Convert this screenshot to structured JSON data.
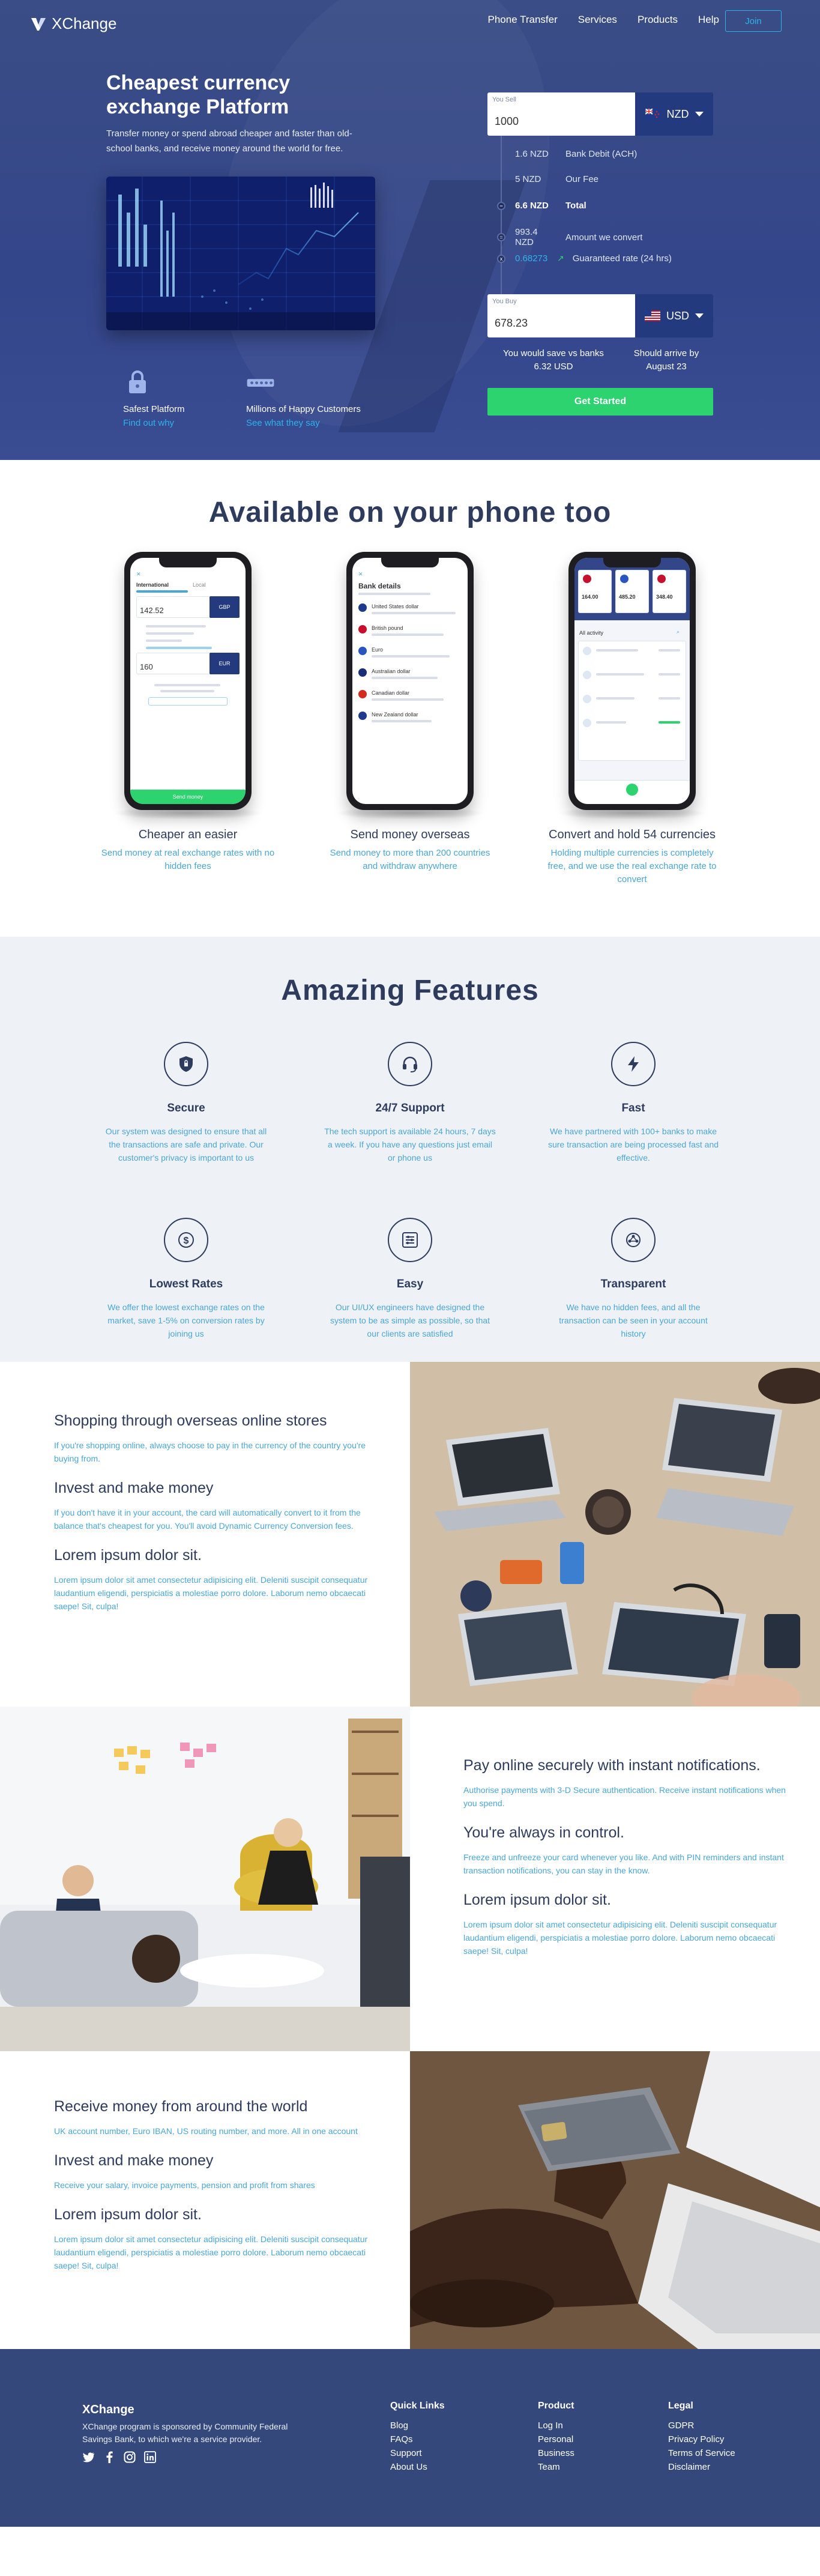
{
  "nav": {
    "brand": "XChange",
    "links": [
      "Phone Transfer",
      "Services",
      "Products",
      "Help"
    ],
    "join": "Join"
  },
  "hero": {
    "title": "Cheapest currency exchange Platform",
    "description": "Transfer money or spend abroad cheaper and faster than old-school banks, and receive money around the world for free.",
    "features": [
      {
        "icon": "lock-icon",
        "title": "Safest Platform",
        "link": "Find out why"
      },
      {
        "icon": "users-icon",
        "title": "Millions of Happy Customers",
        "link": "See what they say"
      }
    ]
  },
  "converter": {
    "sell_label": "You Sell",
    "sell_value": "1000",
    "sell_currency": "NZD",
    "breakdown": [
      {
        "amount": "1.6 NZD",
        "label": "Bank Debit (ACH)",
        "symbol": ""
      },
      {
        "amount": "5 NZD",
        "label": "Our Fee",
        "symbol": ""
      },
      {
        "amount": "6.6 NZD",
        "label": "Total",
        "symbol": "="
      },
      {
        "amount": "993.4 NZD",
        "label": "Amount we convert",
        "symbol": "="
      },
      {
        "amount": "0.68273",
        "label": "Guaranteed rate (24 hrs)",
        "symbol": "x"
      }
    ],
    "buy_label": "You Buy",
    "buy_value": "678.23",
    "buy_currency": "USD",
    "save_line1": "You would save vs banks",
    "save_line2": "6.32 USD",
    "arrive_line1": "Should arrive by",
    "arrive_line2": "August 23",
    "cta": "Get Started"
  },
  "phones": {
    "title": "Available on your phone too",
    "items": [
      {
        "title": "Cheaper an easier",
        "desc": "Send money at real exchange rates with no hidden fees"
      },
      {
        "title": "Send money overseas",
        "desc": "Send money to more than 200 countries and withdraw anywhere"
      },
      {
        "title": "Convert and hold 54 currencies",
        "desc": "Holding multiple currencies is completely free, and we use the real exchange rate to convert"
      }
    ],
    "screen1": {
      "tab1": "International",
      "tab2": "Local",
      "sell": "142.52",
      "sell_cur": "GBP",
      "buy": "160",
      "buy_cur": "EUR",
      "btn": "Send money"
    },
    "screen2": {
      "title": "Bank details",
      "countries": [
        "United States dollar",
        "British pound",
        "Euro",
        "Australian dollar",
        "Canadian dollar",
        "New Zealand dollar"
      ]
    },
    "screen3": {
      "balances": [
        "164.00",
        "485.20",
        "348.40"
      ],
      "header": "All activity"
    }
  },
  "features": {
    "title": "Amazing Features",
    "items": [
      {
        "icon": "shield-icon",
        "title": "Secure",
        "desc": "Our system was designed to ensure that all the transactions are safe and private. Our customer's privacy is important to us"
      },
      {
        "icon": "headset-icon",
        "title": "24/7 Support",
        "desc": "The tech support is available 24 hours, 7 days a week. If you have any questions just email or phone us"
      },
      {
        "icon": "bolt-icon",
        "title": "Fast",
        "desc": "We have partnered with 100+ banks to make sure transaction are being processed fast and effective."
      },
      {
        "icon": "dollar-icon",
        "title": "Lowest Rates",
        "desc": "We offer the lowest exchange rates on the market, save 1-5% on conversion rates by joining us"
      },
      {
        "icon": "sliders-icon",
        "title": "Easy",
        "desc": "Our UI/UX engineers have designed the system to be as simple as possible, so that our clients are satisfied"
      },
      {
        "icon": "eye-icon",
        "title": "Transparent",
        "desc": "We have no hidden fees, and all the transaction can be seen in your account history"
      }
    ]
  },
  "split1": {
    "h1": "Shopping through overseas online stores",
    "p1": "If you're shopping online, always choose to pay in the currency of the country you're buying from.",
    "h2": "Invest and make money",
    "p2": "If you don't have it in your account, the card will automatically convert to it from the balance that's cheapest for you. You'll avoid Dynamic Currency Conversion fees.",
    "h3": "Lorem ipsum dolor sit.",
    "p3": "Lorem ipsum dolor sit amet consectetur adipisicing elit. Deleniti suscipit consequatur laudantium eligendi, perspiciatis a molestiae porro dolore. Laborum nemo obcaecati saepe! Sit, culpa!"
  },
  "split2": {
    "h1": "Pay online securely with instant notifications.",
    "p1": "Authorise payments with 3-D Secure authentication. Receive instant notifications when you spend.",
    "h2": "You're always in control.",
    "p2": "Freeze and unfreeze your card whenever you like. And with PIN reminders and instant transaction notifications, you can stay in the know.",
    "h3": "Lorem ipsum dolor sit.",
    "p3": "Lorem ipsum dolor sit amet consectetur adipisicing elit. Deleniti suscipit consequatur laudantium eligendi, perspiciatis a molestiae porro dolore. Laborum nemo obcaecati saepe! Sit, culpa!"
  },
  "split3": {
    "h1": "Receive money from around the world",
    "p1": "UK account number, Euro IBAN, US routing number, and more. All in one account",
    "h2": "Invest and make money",
    "p2": "Receive your salary, invoice payments, pension and profit from shares",
    "h3": "Lorem ipsum dolor sit.",
    "p3": "Lorem ipsum dolor sit amet consectetur adipisicing elit. Deleniti suscipit consequatur laudantium eligendi, perspiciatis a molestiae porro dolore. Laborum nemo obcaecati saepe! Sit, culpa!"
  },
  "footer": {
    "brand": "XChange",
    "desc": "XChange program is sponsored by Community Federal Savings Bank, to which we're a service provider.",
    "social": [
      "twitter-icon",
      "facebook-icon",
      "instagram-icon",
      "linkedin-icon"
    ],
    "cols": [
      {
        "title": "Quick Links",
        "items": [
          "Blog",
          "FAQs",
          "Support",
          "About Us"
        ]
      },
      {
        "title": "Product",
        "items": [
          "Log In",
          "Personal",
          "Business",
          "Team"
        ]
      },
      {
        "title": "Legal",
        "items": [
          "GDPR",
          "Privacy Policy",
          "Terms of Service",
          "Disclaimer"
        ]
      }
    ]
  },
  "colors": {
    "accent": "#2db3ea",
    "cta": "#2dd36f",
    "navy": "#233a7e",
    "text": "#2f3b5c"
  }
}
